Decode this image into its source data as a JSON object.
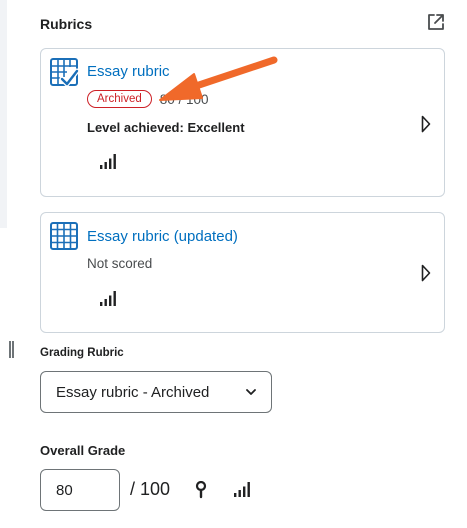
{
  "panel": {
    "title": "Rubrics"
  },
  "rubrics": [
    {
      "name": "Essay rubric",
      "badge": "Archived",
      "score": "80 / 100",
      "level": "Level achieved: Excellent"
    },
    {
      "name": "Essay rubric (updated)",
      "status": "Not scored"
    }
  ],
  "grading_rubric": {
    "label": "Grading Rubric",
    "selected": "Essay rubric - Archived"
  },
  "overall_grade": {
    "label": "Overall Grade",
    "value": "80",
    "out_of": "/ 100"
  },
  "colors": {
    "link": "#006fbf",
    "archived": "#cd2026",
    "annotation_arrow": "#f0692a",
    "icon_blue": "#1b6fb8"
  },
  "icons": [
    "popout-icon",
    "rubric-scored-icon",
    "rubric-grid-icon",
    "signal-bars-icon",
    "chevron-right-icon",
    "chevron-down-icon",
    "pin-icon"
  ]
}
